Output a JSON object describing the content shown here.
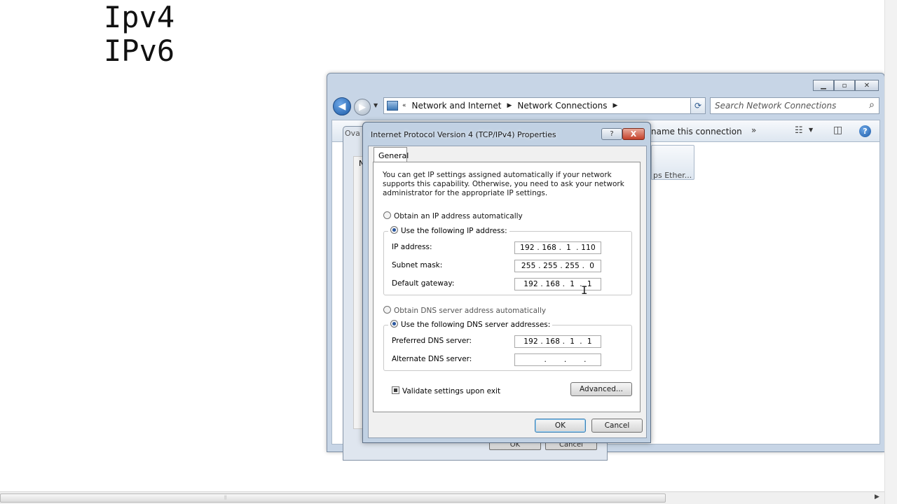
{
  "headings": {
    "line1": "Ipv4",
    "line2": "IPv6"
  },
  "explorer": {
    "address": {
      "prefix": "«",
      "segments": [
        "Network and Internet",
        "Network Connections"
      ]
    },
    "search_placeholder": "Search Network Connections",
    "command_bar": {
      "rename": "name this connection",
      "more": "»"
    },
    "adapter_label": "ps Ether...",
    "icons": [
      "back-arrow-icon",
      "forward-arrow-icon",
      "refresh-icon",
      "search-icon",
      "views-icon",
      "preview-pane-icon",
      "help-icon"
    ]
  },
  "back_dialog": {
    "title_partial": "Ova",
    "side_letter": "N",
    "ok": "OK",
    "cancel": "Cancel"
  },
  "dialog": {
    "title": "Internet Protocol Version 4 (TCP/IPv4) Properties",
    "help_button": "?",
    "close_button": "X",
    "tab": "General",
    "intro": "You can get IP settings assigned automatically if your network supports this capability. Otherwise, you need to ask your network administrator for the appropriate IP settings.",
    "ip_auto": "Obtain an IP address automatically",
    "ip_manual": "Use the following IP address:",
    "ip_address_label": "IP address:",
    "ip_address": "192 . 168 .  1  . 110",
    "subnet_label": "Subnet mask:",
    "subnet": "255 . 255 . 255 .  0",
    "gateway_label": "Default gateway:",
    "gateway": "192 . 168 .  1  .  1",
    "dns_auto": "Obtain DNS server address automatically",
    "dns_manual": "Use the following DNS server addresses:",
    "preferred_dns_label": "Preferred DNS server:",
    "preferred_dns": "192 . 168 .  1  .  1",
    "alternate_dns_label": "Alternate DNS server:",
    "alternate_dns": "      .       .       .",
    "validate": "Validate settings upon exit",
    "validate_checked": true,
    "advanced": "Advanced...",
    "ok": "OK",
    "cancel": "Cancel"
  }
}
